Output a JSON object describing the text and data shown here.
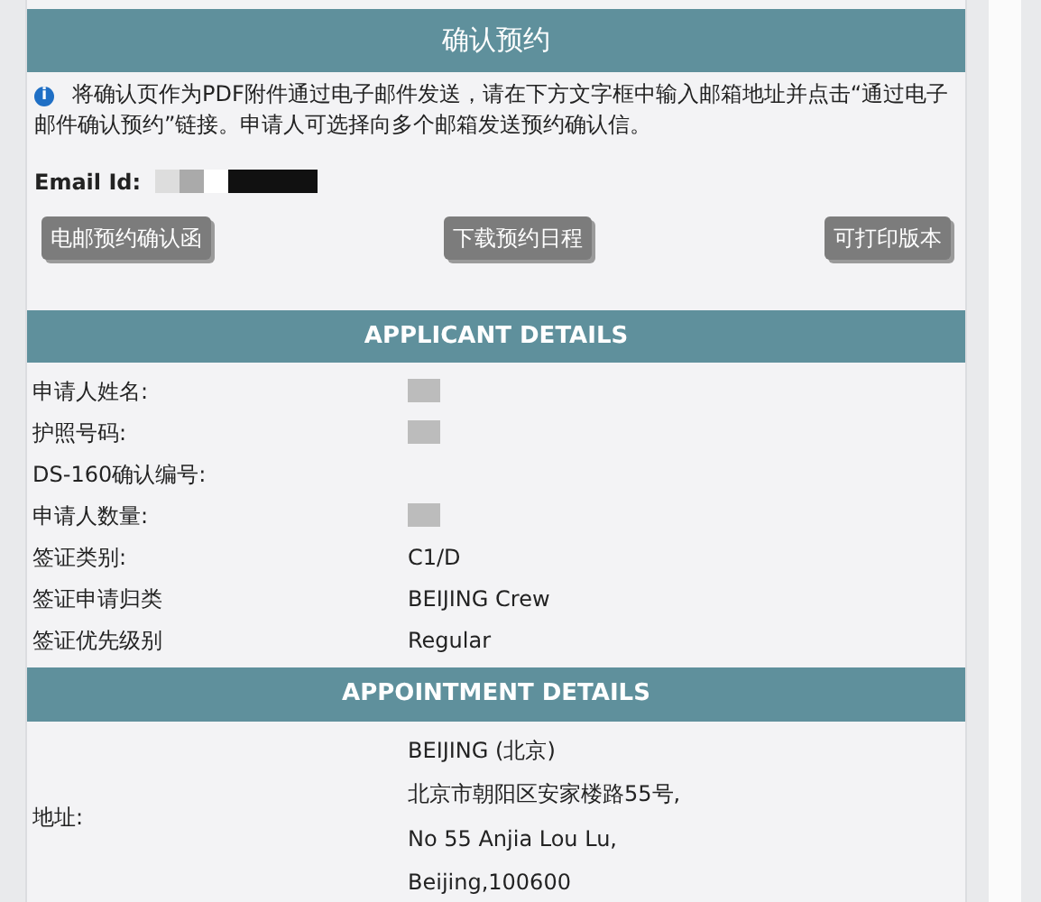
{
  "title": "确认预约",
  "info": {
    "icon": "i",
    "text": "将确认页作为PDF附件通过电子邮件发送，请在下方文字框中输入邮箱地址并点击“通过电子邮件确认预约”链接。申请人可选择向多个邮箱发送预约确认信。"
  },
  "email": {
    "label": "Email Id:",
    "redacted": true
  },
  "buttons": [
    "电邮预约确认函",
    "下载预约日程",
    "可打印版本"
  ],
  "applicant": {
    "heading": "APPLICANT DETAILS",
    "rows": [
      {
        "label": "申请人姓名:",
        "redacted": true
      },
      {
        "label": "护照号码:",
        "redacted": true
      },
      {
        "label": "DS-160确认编号:"
      },
      {
        "label": "申请人数量:",
        "redacted": true
      },
      {
        "label": "签证类别:",
        "value": "C1/D"
      },
      {
        "label": "签证申请归类",
        "value": "BEIJING Crew"
      },
      {
        "label": "签证优先级别",
        "value": "Regular"
      }
    ]
  },
  "appointment": {
    "heading": "APPOINTMENT DETAILS",
    "address_label": "地址:",
    "address_lines": [
      "BEIJING (北京)",
      "北京市朝阳区安家楼路55号,",
      "No 55 Anjia Lou Lu,",
      "Beijing,100600"
    ]
  }
}
